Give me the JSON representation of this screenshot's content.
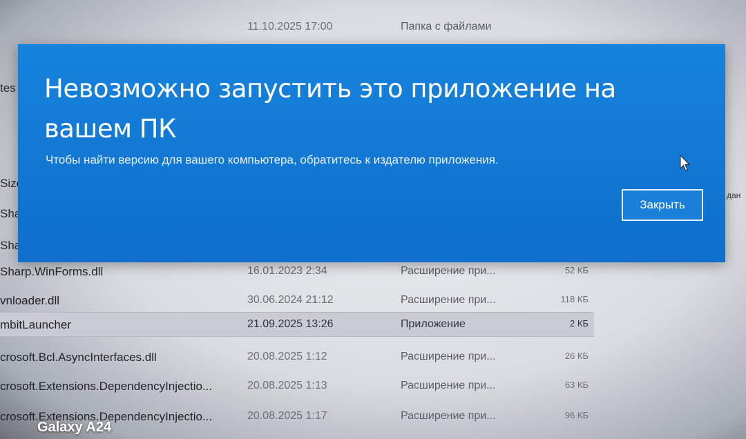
{
  "background": {
    "top_rows": [
      {
        "date": "11.10.2025 17:00",
        "type": "Папка с файлами"
      }
    ],
    "side_labels": [
      "tes",
      "Size",
      "Shar",
      "Shar"
    ],
    "rows": [
      {
        "name": "Sharp.WinForms.dll",
        "date": "16.01.2023 2:34",
        "type": "Расширение при...",
        "size": "52 КБ",
        "selected": false
      },
      {
        "name": "vnloader.dll",
        "date": "30.06.2024 21:12",
        "type": "Расширение при...",
        "size": "118 КБ",
        "selected": false
      },
      {
        "name": "mbitLauncher",
        "date": "21.09.2025 13:26",
        "type": "Приложение",
        "size": "2 КБ",
        "selected": true
      },
      {
        "name": "crosoft.Bcl.AsyncInterfaces.dll",
        "date": "20.08.2025 1:12",
        "type": "Расширение при...",
        "size": "26 КБ",
        "selected": false
      },
      {
        "name": "crosoft.Extensions.DependencyInjectio...",
        "date": "20.08.2025 1:13",
        "type": "Расширение при...",
        "size": "63 КБ",
        "selected": false
      },
      {
        "name": "crosoft.Extensions.DependencyInjectio...",
        "date": "20.08.2025 1:17",
        "type": "Расширение при...",
        "size": "96 КБ",
        "selected": false
      }
    ],
    "right_fragment": "дан"
  },
  "dialog": {
    "title": "Невозможно запустить это приложение на вашем ПК",
    "message": "Чтобы найти версию для вашего компьютера, обратитесь к издателю приложения.",
    "close_label": "Закрыть"
  },
  "watermark": "Galaxy A24",
  "colors": {
    "dialog_blue": "#137ad6",
    "selected_row": "#c9ccd2"
  }
}
